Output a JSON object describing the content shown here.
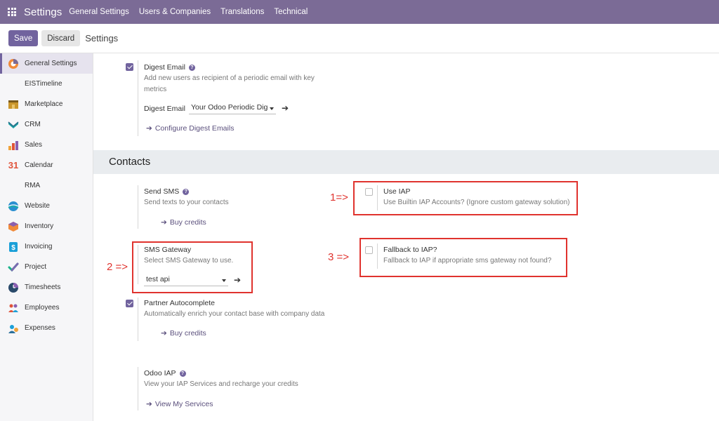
{
  "topbar": {
    "app_name": "Settings",
    "nav": [
      "General Settings",
      "Users & Companies",
      "Translations",
      "Technical"
    ]
  },
  "control": {
    "save_label": "Save",
    "discard_label": "Discard",
    "breadcrumb": "Settings"
  },
  "sidebar": {
    "items": [
      {
        "label": "General Settings",
        "icon": "settings-icon"
      },
      {
        "label": "EISTimeline",
        "icon": ""
      },
      {
        "label": "Marketplace",
        "icon": "marketplace-icon"
      },
      {
        "label": "CRM",
        "icon": "crm-icon"
      },
      {
        "label": "Sales",
        "icon": "sales-icon"
      },
      {
        "label": "Calendar",
        "icon": "calendar-icon"
      },
      {
        "label": "RMA",
        "icon": ""
      },
      {
        "label": "Website",
        "icon": "website-icon"
      },
      {
        "label": "Inventory",
        "icon": "inventory-icon"
      },
      {
        "label": "Invoicing",
        "icon": "invoicing-icon"
      },
      {
        "label": "Project",
        "icon": "project-icon"
      },
      {
        "label": "Timesheets",
        "icon": "timesheets-icon"
      },
      {
        "label": "Employees",
        "icon": "employees-icon"
      },
      {
        "label": "Expenses",
        "icon": "expenses-icon"
      }
    ],
    "calendar_glyph": "31"
  },
  "digest": {
    "title": "Digest Email",
    "description": "Add new users as recipient of a periodic email with key metrics",
    "field_label": "Digest Email",
    "field_value": "Your Odoo Periodic Digest",
    "link": "Configure Digest Emails",
    "checked": true
  },
  "contacts": {
    "section_title": "Contacts",
    "send_sms": {
      "title": "Send SMS",
      "description": "Send texts to your contacts",
      "link": "Buy credits"
    },
    "use_iap": {
      "title": "Use IAP",
      "description": "Use Builtin IAP Accounts? (Ignore custom gateway solution)",
      "checked": false
    },
    "sms_gateway": {
      "title": "SMS Gateway",
      "description": "Select SMS Gateway to use.",
      "value": "test api"
    },
    "fallback_iap": {
      "title": "Fallback to IAP?",
      "description": "Fallback to IAP if appropriate sms gateway not found?",
      "checked": false
    },
    "partner_autocomplete": {
      "title": "Partner Autocomplete",
      "description": "Automatically enrich your contact base with company data",
      "link": "Buy credits",
      "checked": true
    },
    "odoo_iap": {
      "title": "Odoo IAP",
      "description": "View your IAP Services and recharge your credits",
      "link": "View My Services"
    }
  },
  "annotations": {
    "label1": "1=>",
    "label2": "2 =>",
    "label3": "3 =>",
    "color": "#e0332e"
  },
  "colors": {
    "brand": "#7b6b96",
    "primary": "#71639e",
    "link": "#5a4f7c"
  }
}
